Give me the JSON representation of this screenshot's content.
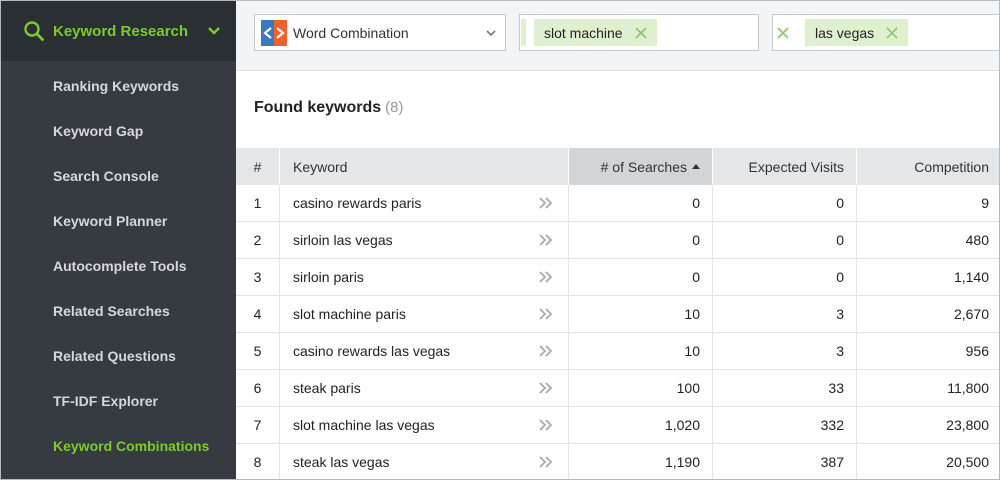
{
  "sidebar": {
    "header": {
      "label": "Keyword Research",
      "icon": "search-icon"
    },
    "accent_color": "#7ccb2b",
    "items": [
      {
        "label": "Ranking Keywords",
        "active": false
      },
      {
        "label": "Keyword Gap",
        "active": false
      },
      {
        "label": "Search Console",
        "active": false
      },
      {
        "label": "Keyword Planner",
        "active": false
      },
      {
        "label": "Autocomplete Tools",
        "active": false
      },
      {
        "label": "Related Searches",
        "active": false
      },
      {
        "label": "Related Questions",
        "active": false
      },
      {
        "label": "TF-IDF Explorer",
        "active": false
      },
      {
        "label": "Keyword Combinations",
        "active": true
      }
    ]
  },
  "toolbar": {
    "mode_select": {
      "value": "Word Combination",
      "icon": "word-combination-logo-icon"
    },
    "tag_fields": [
      {
        "tags": [
          "slot machine"
        ]
      },
      {
        "tags": [
          "las vegas"
        ]
      }
    ]
  },
  "results": {
    "title": "Found keywords",
    "count": "(8)"
  },
  "table": {
    "columns": [
      "#",
      "Keyword",
      "# of Searches",
      "Expected Visits",
      "Competition"
    ],
    "sorted_column": "# of Searches",
    "sort_direction": "ascending",
    "rows": [
      {
        "n": "1",
        "keyword": "casino rewards paris",
        "searches": "0",
        "visits": "0",
        "competition": "9"
      },
      {
        "n": "2",
        "keyword": "sirloin las vegas",
        "searches": "0",
        "visits": "0",
        "competition": "480"
      },
      {
        "n": "3",
        "keyword": "sirloin paris",
        "searches": "0",
        "visits": "0",
        "competition": "1,140"
      },
      {
        "n": "4",
        "keyword": "slot machine paris",
        "searches": "10",
        "visits": "3",
        "competition": "2,670"
      },
      {
        "n": "5",
        "keyword": "casino rewards las vegas",
        "searches": "10",
        "visits": "3",
        "competition": "956"
      },
      {
        "n": "6",
        "keyword": "steak paris",
        "searches": "100",
        "visits": "33",
        "competition": "11,800"
      },
      {
        "n": "7",
        "keyword": "slot machine las vegas",
        "searches": "1,020",
        "visits": "332",
        "competition": "23,800"
      },
      {
        "n": "8",
        "keyword": "steak las vegas",
        "searches": "1,190",
        "visits": "387",
        "competition": "20,500"
      }
    ]
  }
}
